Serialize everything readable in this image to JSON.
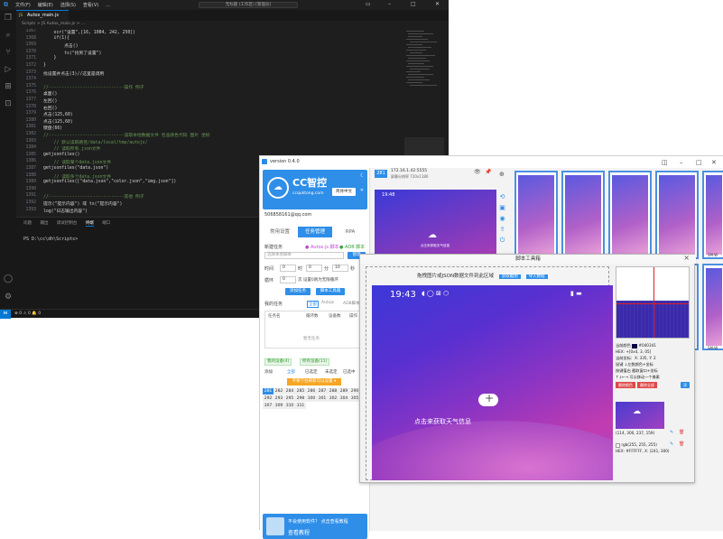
{
  "vscode": {
    "menu": [
      "文件(F)",
      "编辑(E)",
      "选择(S)",
      "查看(V)",
      "..."
    ],
    "command_center": "无标题 (工作区) [管理员]",
    "tab": "Autox_main.js",
    "breadcrumb": "Scripts > JS Autox_main.js > ...",
    "lines": [
      {
        "n": "1367",
        "t": "    ocr(\"设置\",[16, 1084, 242, 250])"
      },
      {
        "n": "1368",
        "t": "    if(1){"
      },
      {
        "n": "1369",
        "t": "        点击()"
      },
      {
        "n": "1370",
        "t": "        ts(\"找到了设置\")"
      },
      {
        "n": "1371",
        "t": "    }"
      },
      {
        "n": "1372",
        "t": "}"
      },
      {
        "n": "1373",
        "t": "找设置并点击(3)//这里是调用"
      },
      {
        "n": "1374",
        "t": ""
      },
      {
        "n": "1375",
        "t": "//-----------------------------操作 例子"
      },
      {
        "n": "1376",
        "t": "桌面()"
      },
      {
        "n": "1377",
        "t": "左回()"
      },
      {
        "n": "1378",
        "t": "右回()"
      },
      {
        "n": "1379",
        "t": "点击(125,60)"
      },
      {
        "n": "1380",
        "t": "点击(125,60)"
      },
      {
        "n": "1381",
        "t": "键盘(66)"
      },
      {
        "n": "1382",
        "t": "//-----------------------------读取本地数据文件 包含颜色代码 图片 坐标"
      },
      {
        "n": "1383",
        "t": "    // 默认读取路径/data/local/tmp/autojs/"
      },
      {
        "n": "1384",
        "t": "    // 读取所有.json文件"
      },
      {
        "n": "1385",
        "t": "getjsonfiles()"
      },
      {
        "n": "1386",
        "t": "    // 读取某个data.json文件"
      },
      {
        "n": "1387",
        "t": "getjsonfiles(\"data.json\")"
      },
      {
        "n": "1388",
        "t": "    // 读取多个data.json文件"
      },
      {
        "n": "1389",
        "t": "getjsonfiles([\"data.json\",\"color.json\",\"img.json\"])"
      },
      {
        "n": "1390",
        "t": ""
      },
      {
        "n": "1391",
        "t": "//-----------------------------其他 例子"
      },
      {
        "n": "1392",
        "t": "提示(\"提示内容\") 或 ts(\"提示内容\")"
      },
      {
        "n": "1393",
        "t": "log(\"日志输出内容\")"
      }
    ],
    "panel_tabs": [
      "问题",
      "输出",
      "调试控制台",
      "终端",
      "端口"
    ],
    "terminal": "PS D:\\cc\\dh\\Scripts>",
    "status": "⊗ 0  ⚠ 0   🔔 0"
  },
  "cc": {
    "title": "version 0.4.0",
    "logo_title": "CC智控",
    "logo_sub": "ccquktong.com",
    "lang": "简体中文",
    "email": "506858161@qq.com",
    "tabs": [
      "常用设置",
      "任务管理",
      "RPA"
    ],
    "new_task_label": "新建任务",
    "autojs_label": "● Autox.js 脚本",
    "adb_label": "● ADB 脚本",
    "select_placeholder": "选择本地脚本",
    "manage_btn": "管理",
    "time_label": "时间",
    "h_val": "0",
    "h_unit": "时",
    "m_val": "0",
    "m_unit": "分",
    "s_val": "10",
    "s_unit": "秒",
    "loop_label": "循环",
    "loop_val": "0",
    "loop_desc": "次 设置0则为无限循环",
    "add_task_btn": "添加任务",
    "script_tool_btn": "脚本工具箱",
    "my_tasks": "我的任务",
    "filters": [
      "全部",
      "Autojs",
      "ADB脚本"
    ],
    "table_headers": [
      "任务名",
      "循环数",
      "设备数",
      "操作"
    ],
    "empty": "暂无任务",
    "green_tabs": [
      "我的设备(4)",
      "所有设备(11)"
    ],
    "device_filter": [
      "添加",
      "全部",
      "已选定",
      "未选定",
      "已选中"
    ],
    "dropdown": "不要下拉刷新可以设置 ▾",
    "device_nums": [
      "281",
      "282",
      "284",
      "285",
      "286",
      "287",
      "288",
      "289",
      "290",
      "292",
      "293",
      "295",
      "298",
      "300",
      "301",
      "302",
      "304",
      "305",
      "307",
      "309",
      "310",
      "311"
    ],
    "ad_line1": "不会使用软件？ 点击查看教程",
    "ad_line2": "查看教程",
    "device_badge": "281",
    "device_ip": "172.16.1.42:5555",
    "device_res": "屏幕分辨率 720x1180",
    "phone_time": "19:48",
    "phone_weather": "点击来获取天气信息",
    "thumb_labels": [
      "SM-W",
      "SM-W"
    ]
  },
  "tool": {
    "title": "脚本工具箱",
    "hint": "拖拽图片或JSON数据文件到此区域",
    "btn_get": "获取截图",
    "btn_import": "导入数据",
    "phone_time": "19:43",
    "weather": "点击来获取天气信息",
    "current_color_label": "当前颜色",
    "current_color": "#040341",
    "hex_line": "HEX: +[0x4, 3, 05]",
    "coord_line": "当前坐标：X: 335, Y: 2",
    "t1": "鼠键 ↓左数颜色+坐标",
    "t2": "按键值右 截取窗口+坐标",
    "t3": "↑↓←→ 可以移动一个像素",
    "btn_del": "删除颜色",
    "btn_del2": "删除全部",
    "btn_add": "添",
    "region": "(114, 300, 237, 159)",
    "rgb": "rgb(255, 255, 255)",
    "hex2": "HEX: #FFFFFF, X: (241, 300)"
  }
}
